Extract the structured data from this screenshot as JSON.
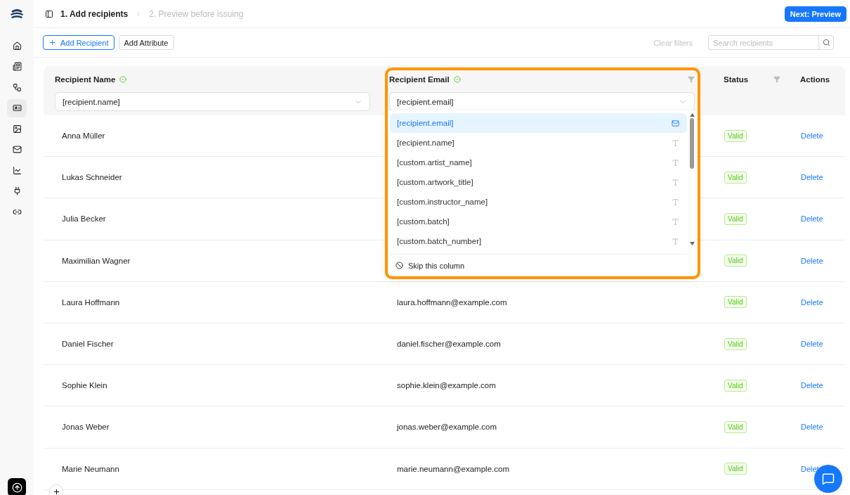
{
  "topbar": {
    "steps": [
      {
        "label": "1. Add recipients",
        "selected": true
      },
      {
        "label": "2. Preview before issuing",
        "selected": false
      }
    ],
    "next_button": "Next: Preview"
  },
  "sidebar": {
    "items": [
      {
        "kind": "home",
        "selected": false
      },
      {
        "kind": "document",
        "selected": false
      },
      {
        "kind": "network",
        "selected": false
      },
      {
        "kind": "certificate",
        "selected": true
      },
      {
        "kind": "image",
        "selected": false
      },
      {
        "kind": "mail",
        "selected": false
      },
      {
        "kind": "chart",
        "selected": false
      },
      {
        "kind": "plug",
        "selected": false
      },
      {
        "kind": "link",
        "selected": false
      }
    ]
  },
  "toolbar": {
    "add_recipient": "Add Recipient",
    "add_attribute": "Add Attribute",
    "clear_filters": {
      "label": "Clear filters",
      "disabled": true
    },
    "search": {
      "placeholder": "Search recipients"
    }
  },
  "table": {
    "columns": [
      {
        "label": "Recipient Name",
        "mapped": true,
        "value": "[recipient.name]",
        "filter": false
      },
      {
        "label": "Recipient Email",
        "mapped": true,
        "value": "[recipient.email]",
        "filter": true
      },
      {
        "label": "Status",
        "filter": true
      },
      {
        "label": "Actions",
        "filter": false
      }
    ],
    "rows": [
      {
        "name": "Anna Müller",
        "status": "Valid",
        "action": "Delete"
      },
      {
        "name": "Lukas Schneider",
        "status": "Valid",
        "action": "Delete"
      },
      {
        "name": "Julia Becker",
        "status": "Valid",
        "action": "Delete"
      },
      {
        "name": "Maximilian Wagner",
        "status": "Valid",
        "action": "Delete"
      },
      {
        "name": "Laura Hoffmann",
        "email": "laura.hoffmann@example.com",
        "status": "Valid",
        "action": "Delete"
      },
      {
        "name": "Daniel Fischer",
        "email": "daniel.fischer@example.com",
        "status": "Valid",
        "action": "Delete"
      },
      {
        "name": "Sophie Klein",
        "email": "sophie.klein@example.com",
        "status": "Valid",
        "action": "Delete"
      },
      {
        "name": "Jonas Weber",
        "email": "jonas.weber@example.com",
        "status": "Valid",
        "action": "Delete"
      },
      {
        "name": "Marie Neumann",
        "email": "marie.neumann@example.com",
        "status": "Valid",
        "action": "Delet"
      }
    ]
  },
  "mapping_menu": {
    "options": [
      {
        "label": "[recipient.email]",
        "kind": "email",
        "selected": true
      },
      {
        "label": "[recipient.name]",
        "kind": "text",
        "selected": false
      },
      {
        "label": "[custom.artist_name]",
        "kind": "text",
        "selected": false
      },
      {
        "label": "[custom.artwork_title]",
        "kind": "text",
        "selected": false
      },
      {
        "label": "[custom.instructor_name]",
        "kind": "text",
        "selected": false
      },
      {
        "label": "[custom.batch]",
        "kind": "text",
        "selected": false
      },
      {
        "label": "[custom.batch_number]",
        "kind": "text",
        "selected": false
      }
    ],
    "skip": "Skip this column"
  }
}
